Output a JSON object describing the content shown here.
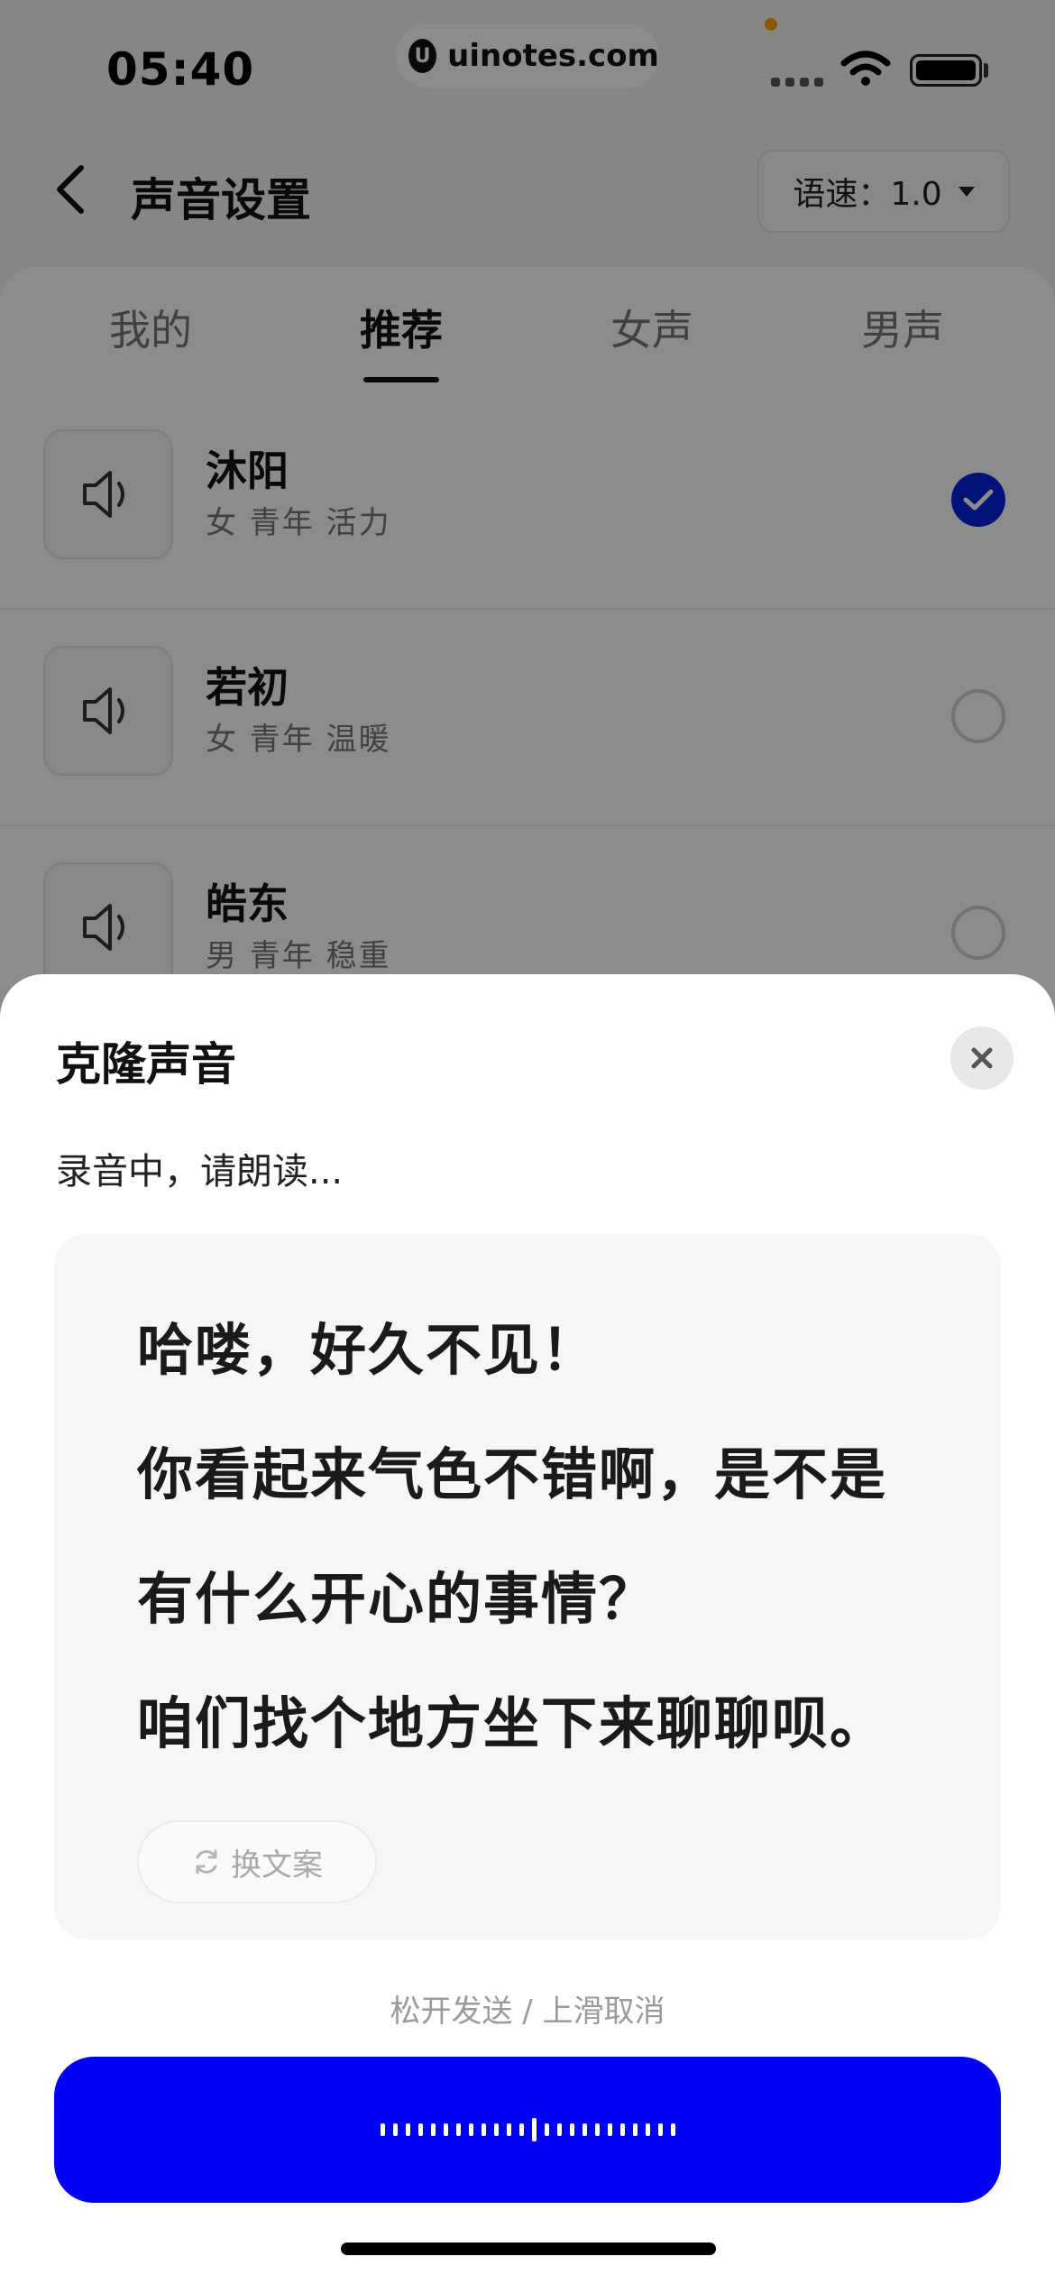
{
  "status_bar": {
    "time": "05:40",
    "watermark": "uinotes.com",
    "watermark_logo": "U"
  },
  "header": {
    "title": "声音设置",
    "speed_label": "语速：1.0"
  },
  "tabs": [
    {
      "label": "我的"
    },
    {
      "label": "推荐"
    },
    {
      "label": "女声"
    },
    {
      "label": "男声"
    }
  ],
  "voices": [
    {
      "name": "沐阳",
      "tags": "女 青年 活力",
      "selected": true
    },
    {
      "name": "若初",
      "tags": "女 青年 温暖",
      "selected": false
    },
    {
      "name": "皓东",
      "tags": "男 青年 稳重",
      "selected": false
    }
  ],
  "sheet": {
    "title": "克隆声音",
    "status": "录音中，请朗读...",
    "script_lines": [
      "哈喽，好久不见！",
      "你看起来气色不错啊，是不是",
      "有什么开心的事情？",
      "咱们找个地方坐下来聊聊呗。"
    ],
    "refresh_label": "换文案",
    "hint": "松开发送 / 上滑取消"
  },
  "colors": {
    "accent": "#0000f5",
    "check": "#0a1fe0",
    "overlay": "rgba(0,0,0,0.45)"
  }
}
